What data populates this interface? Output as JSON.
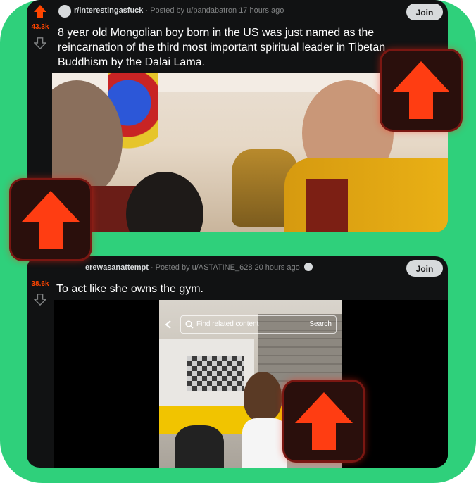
{
  "posts": [
    {
      "subreddit": "r/interestingasfuck",
      "meta": "· Posted by u/pandabatron 17 hours ago",
      "votes": "43.3k",
      "join_label": "Join",
      "title": "8 year old Mongolian boy born in the US was just named as the reincarnation of the third most important spiritual leader in Tibetan Buddhism by the Dalai Lama."
    },
    {
      "subreddit": "r/therewasanattempt",
      "subreddit_visible": "erewasanattempt",
      "meta": "· Posted by u/ASTATINE_628 20 hours ago",
      "votes": "38.6k",
      "join_label": "Join",
      "title": "To act like she owns the gym.",
      "video_search_placeholder": "Find related content",
      "video_search_button": "Search"
    }
  ],
  "colors": {
    "background": "#2fd07b",
    "card": "#111213",
    "upvote": "#ff4500",
    "overlay_arrow": "#ff3d12",
    "join_button": "#d7dadc"
  },
  "icons": [
    "upvote-icon",
    "downvote-icon",
    "subreddit-avatar",
    "search-icon",
    "back-chevron-icon",
    "award-icon"
  ]
}
